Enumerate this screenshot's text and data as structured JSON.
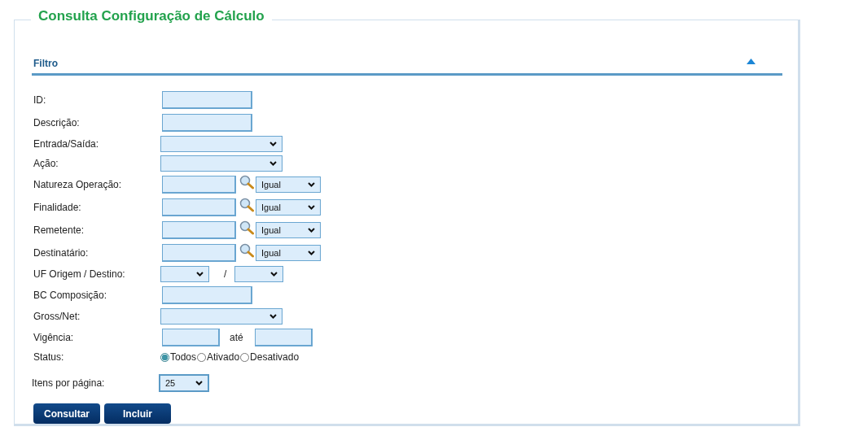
{
  "title": "Consulta Configuração de Cálculo",
  "filter": {
    "title": "Filtro",
    "expanded": true
  },
  "fields": [
    {
      "kind": "text",
      "label": "ID:"
    },
    {
      "kind": "text",
      "label": "Descrição:"
    },
    {
      "kind": "select",
      "label": "Entrada/Saída:"
    },
    {
      "kind": "select",
      "label": "Ação:"
    },
    {
      "kind": "lookup",
      "label": "Natureza Operação:",
      "operator": "Igual"
    },
    {
      "kind": "lookup",
      "label": "Finalidade:",
      "operator": "Igual"
    },
    {
      "kind": "lookup",
      "label": "Remetente:",
      "operator": "Igual"
    },
    {
      "kind": "lookup",
      "label": "Destinatário:",
      "operator": "Igual"
    },
    {
      "kind": "pair",
      "label": "UF Origem / Destino:",
      "separator": "/"
    },
    {
      "kind": "text",
      "label": "BC Composição:"
    },
    {
      "kind": "select",
      "label": "Gross/Net:"
    },
    {
      "kind": "range",
      "label": "Vigência:",
      "separator": "até"
    },
    {
      "kind": "radio",
      "label": "Status:",
      "options": [
        {
          "label": "Todos",
          "selected": true
        },
        {
          "label": "Ativado",
          "selected": false
        },
        {
          "label": "Desativado",
          "selected": false
        }
      ]
    }
  ],
  "page_size": {
    "label": "Itens por página:",
    "value": "25"
  },
  "buttons": [
    "Consultar",
    "Incluir"
  ]
}
